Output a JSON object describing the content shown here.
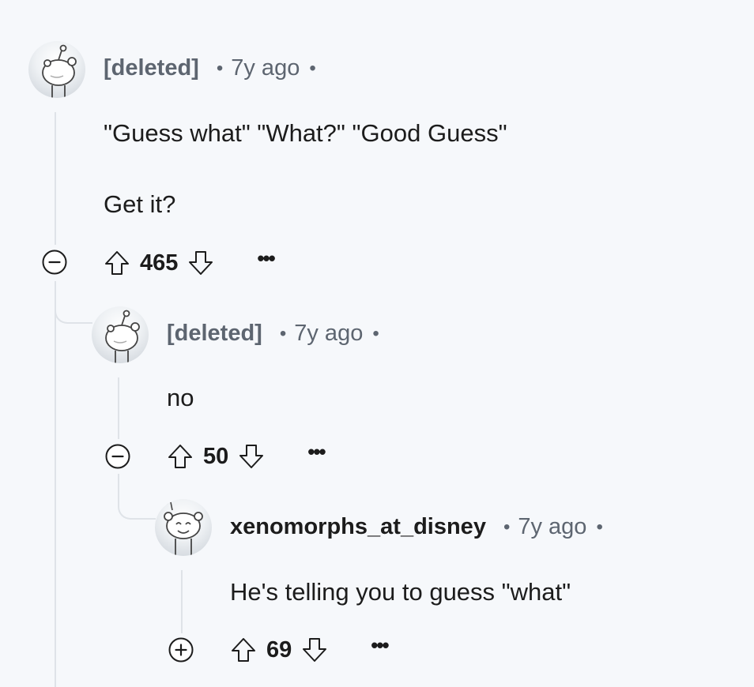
{
  "comments": [
    {
      "author": "[deleted]",
      "age": "7y ago",
      "body": [
        "\"Guess what\" \"What?\" \"Good Guess\"",
        "Get it?"
      ],
      "score": "465",
      "toggle": "collapse"
    },
    {
      "author": "[deleted]",
      "age": "7y ago",
      "body": [
        "no"
      ],
      "score": "50",
      "toggle": "collapse"
    },
    {
      "author": "xenomorphs_at_disney",
      "age": "7y ago",
      "body": [
        "He's telling you to guess \"what\""
      ],
      "score": "69",
      "toggle": "expand"
    }
  ],
  "icons": {
    "upvote": "upvote-icon",
    "downvote": "downvote-icon",
    "more": "overflow-menu-icon",
    "collapse": "minus-circle-icon",
    "expand": "plus-circle-icon",
    "avatar": "snoo-avatar-icon"
  },
  "separator": "•",
  "more_glyph": "•••"
}
